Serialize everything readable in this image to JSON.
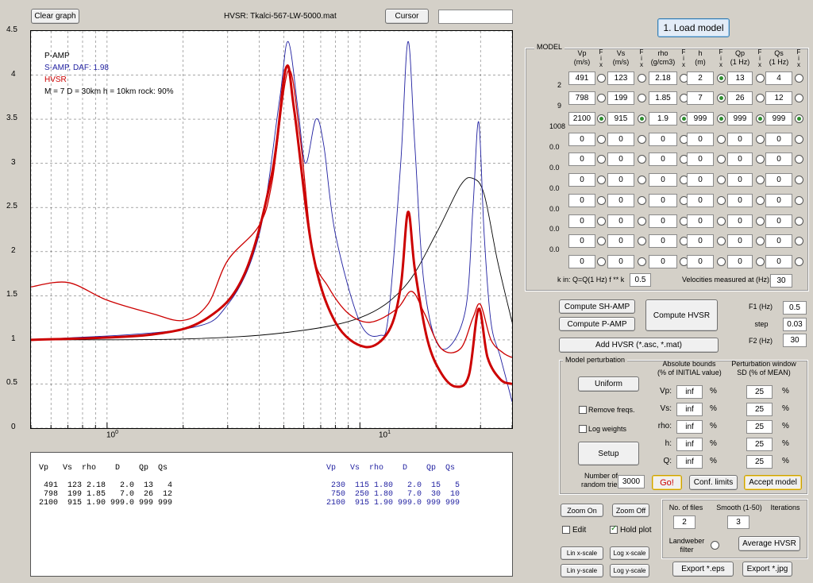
{
  "top": {
    "clear_graph": "Clear graph",
    "cursor": "Cursor",
    "cursor_field": "",
    "load_model": "1. Load model"
  },
  "plot": {
    "title": "HVSR:  Tkalci-567-LW-5000.mat",
    "y_ticks": [
      "4.5",
      "4",
      "3.5",
      "3",
      "2.5",
      "2",
      "1.5",
      "1",
      "0.5",
      "0"
    ],
    "x_tick_1": "10",
    "x_tick_1_exp": "0",
    "x_tick_2": "10",
    "x_tick_2_exp": "1",
    "legend": {
      "p_amp": "P-AMP",
      "s_amp": "S-AMP, DAF: 1.98",
      "hvsr": "HVSR",
      "params": "M = 7  D = 30km  h = 10km  rock: 90%"
    },
    "colors": {
      "p_amp": "#000000",
      "s_amp": "#1f1fa0",
      "hvsr": "#cc0000"
    }
  },
  "chart_data": {
    "type": "line",
    "x_scale": "log",
    "xlim": [
      0.5,
      40
    ],
    "ylim": [
      0,
      4.5
    ],
    "grid": true,
    "series": [
      {
        "name": "P-AMP",
        "color": "#000000",
        "points": [
          [
            0.5,
            1.0
          ],
          [
            2,
            1.01
          ],
          [
            5,
            1.08
          ],
          [
            10,
            1.25
          ],
          [
            15,
            1.6
          ],
          [
            20,
            2.2
          ],
          [
            25,
            2.75
          ],
          [
            28,
            2.83
          ],
          [
            31,
            2.65
          ],
          [
            35,
            1.9
          ],
          [
            40,
            1.2
          ]
        ]
      },
      {
        "name": "S-AMP, DAF: 1.98",
        "color": "#1f1fa0",
        "points": [
          [
            0.5,
            1.0
          ],
          [
            2,
            1.12
          ],
          [
            3,
            1.4
          ],
          [
            4,
            2.2
          ],
          [
            4.8,
            3.7
          ],
          [
            5.2,
            4.38
          ],
          [
            5.7,
            3.6
          ],
          [
            6.1,
            3.0
          ],
          [
            6.7,
            3.5
          ],
          [
            7.2,
            3.2
          ],
          [
            8,
            2.2
          ],
          [
            10,
            1.2
          ],
          [
            12,
            1.05
          ],
          [
            13,
            1.3
          ],
          [
            14.5,
            3.0
          ],
          [
            15.5,
            4.38
          ],
          [
            16.5,
            3.2
          ],
          [
            18,
            1.6
          ],
          [
            21,
            0.9
          ],
          [
            26,
            1.3
          ],
          [
            28,
            2.5
          ],
          [
            29.5,
            3.47
          ],
          [
            31,
            2.2
          ],
          [
            33,
            1.2
          ],
          [
            36,
            0.8
          ],
          [
            40,
            0.3
          ]
        ]
      },
      {
        "name": "HVSR",
        "color": "#cc0000",
        "points": [
          [
            0.5,
            1.6
          ],
          [
            0.7,
            1.65
          ],
          [
            1.0,
            1.45
          ],
          [
            1.5,
            1.3
          ],
          [
            2,
            1.22
          ],
          [
            2.5,
            1.4
          ],
          [
            3,
            1.9
          ],
          [
            4,
            2.3
          ],
          [
            4.5,
            2.8
          ],
          [
            5.2,
            4.05
          ],
          [
            5.8,
            3.3
          ],
          [
            6.5,
            2.0
          ],
          [
            7.5,
            1.6
          ],
          [
            9,
            1.3
          ],
          [
            11,
            1.2
          ],
          [
            14,
            1.35
          ],
          [
            16,
            1.55
          ],
          [
            18,
            1.3
          ],
          [
            21,
            0.9
          ],
          [
            25,
            0.9
          ],
          [
            28,
            1.25
          ],
          [
            30,
            1.4
          ],
          [
            33,
            1.0
          ],
          [
            37,
            0.85
          ],
          [
            40,
            0.8
          ]
        ]
      },
      {
        "name": "",
        "color": "#cc0000",
        "points": [
          [
            0.5,
            1.0
          ],
          [
            1.5,
            1.06
          ],
          [
            2.5,
            1.25
          ],
          [
            3.5,
            1.75
          ],
          [
            4.5,
            2.9
          ],
          [
            5.1,
            4.08
          ],
          [
            5.5,
            3.6
          ],
          [
            6.5,
            2.0
          ],
          [
            8,
            1.2
          ],
          [
            10.5,
            0.92
          ],
          [
            13,
            1.1
          ],
          [
            14.5,
            1.6
          ],
          [
            15.5,
            2.45
          ],
          [
            16.5,
            1.8
          ],
          [
            18.5,
            1.0
          ],
          [
            21,
            0.62
          ],
          [
            24,
            0.47
          ],
          [
            27,
            0.6
          ],
          [
            29.5,
            1.35
          ],
          [
            32,
            0.8
          ],
          [
            36,
            0.55
          ],
          [
            40,
            0.5
          ]
        ]
      }
    ]
  },
  "model": {
    "title": "MODEL",
    "col_labels": [
      "Vp\n(m/s)",
      "Vs\n(m/s)",
      "rho\n(g/cm3)",
      "h\n(m)",
      "Qp\n(1 Hz)",
      "Qs\n(1 Hz)"
    ],
    "fix_label": "F\ni\nx",
    "row_left": [
      "",
      "2",
      "9",
      "1008",
      "0.0",
      "0.0",
      "0.0",
      "0.0",
      "0.0",
      "0.0"
    ],
    "rows": [
      [
        "491",
        "123",
        "2.18",
        "2",
        "13",
        "4"
      ],
      [
        "798",
        "199",
        "1.85",
        "7",
        "26",
        "12"
      ],
      [
        "2100",
        "915",
        "1.9",
        "999",
        "999",
        "999"
      ],
      [
        "0",
        "0",
        "0",
        "0",
        "0",
        "0"
      ],
      [
        "0",
        "0",
        "0",
        "0",
        "0",
        "0"
      ],
      [
        "0",
        "0",
        "0",
        "0",
        "0",
        "0"
      ],
      [
        "0",
        "0",
        "0",
        "0",
        "0",
        "0"
      ],
      [
        "0",
        "0",
        "0",
        "0",
        "0",
        "0"
      ],
      [
        "0",
        "0",
        "0",
        "0",
        "0",
        "0"
      ],
      [
        "0",
        "0",
        "0",
        "0",
        "0",
        "0"
      ]
    ],
    "fix_on": [
      [
        false,
        false,
        false,
        true,
        false,
        false
      ],
      [
        false,
        false,
        false,
        true,
        false,
        false
      ],
      [
        true,
        true,
        true,
        true,
        true,
        true
      ],
      [
        false,
        false,
        false,
        false,
        false,
        false
      ],
      [
        false,
        false,
        false,
        false,
        false,
        false
      ],
      [
        false,
        false,
        false,
        false,
        false,
        false
      ],
      [
        false,
        false,
        false,
        false,
        false,
        false
      ],
      [
        false,
        false,
        false,
        false,
        false,
        false
      ],
      [
        false,
        false,
        false,
        false,
        false,
        false
      ],
      [
        false,
        false,
        false,
        false,
        false,
        false
      ]
    ],
    "k_label": "k in: Q=Q(1 Hz) f ** k",
    "k_value": "0.5",
    "vel_label": "Velocities measured at (Hz):",
    "vel_value": "30"
  },
  "compute": {
    "sh_amp": "Compute SH-AMP",
    "p_amp": "Compute P-AMP",
    "hvsr": "Compute HVSR",
    "add_hvsr": "Add HVSR (*.asc, *.mat)",
    "f1_label": "F1 (Hz)",
    "f1": "0.5",
    "step_label": "step",
    "step": "0.03",
    "f2_label": "F2 (Hz)",
    "f2": "30"
  },
  "perturb": {
    "title": "Model perturbation",
    "abs_head": "Absolute bounds\n(% of INITIAL value)",
    "pw_head": "Perturbation window\nSD (% of MEAN)",
    "uniform": "Uniform",
    "remove_freqs": "Remove freqs.",
    "log_weights": "Log weights",
    "setup": "Setup",
    "labels": [
      "Vp:",
      "Vs:",
      "rho:",
      "h:",
      "Q:"
    ],
    "abs": [
      "inf",
      "inf",
      "inf",
      "inf",
      "inf"
    ],
    "pw": [
      "25",
      "25",
      "25",
      "25",
      "25"
    ],
    "pct": "%",
    "tries_label": "Number of\nrandom tries",
    "tries": "3000",
    "go": "Go!",
    "conf_limits": "Conf. limits",
    "accept": "Accept model"
  },
  "bottom": {
    "zoom_on": "Zoom On",
    "zoom_off": "Zoom Off",
    "edit": "Edit",
    "hold_plot": "Hold plot",
    "lin_x": "Lin x-scale",
    "log_x": "Log x-scale",
    "lin_y": "Lin y-scale",
    "log_y": "Log y-scale",
    "nfiles_label": "No. of files",
    "nfiles": "2",
    "smooth_label": "Smooth (1-50)",
    "smooth": "3",
    "iterations": "Iterations",
    "landweber": "Landweber\nfilter",
    "average": "Average HVSR",
    "export_eps": "Export *.eps",
    "export_jpg": "Export *.jpg"
  },
  "text_out": {
    "left": "Vp   Vs  rho    D    Qp  Qs\n\n 491  123 2.18   2.0  13   4\n 798  199 1.85   7.0  26  12\n2100  915 1.90 999.0 999 999",
    "right": "Vp   Vs  rho    D    Qp  Qs\n\n 230  115 1.80   2.0  15   5\n 750  250 1.80   7.0  30  10\n2100  915 1.90 999.0 999 999"
  }
}
